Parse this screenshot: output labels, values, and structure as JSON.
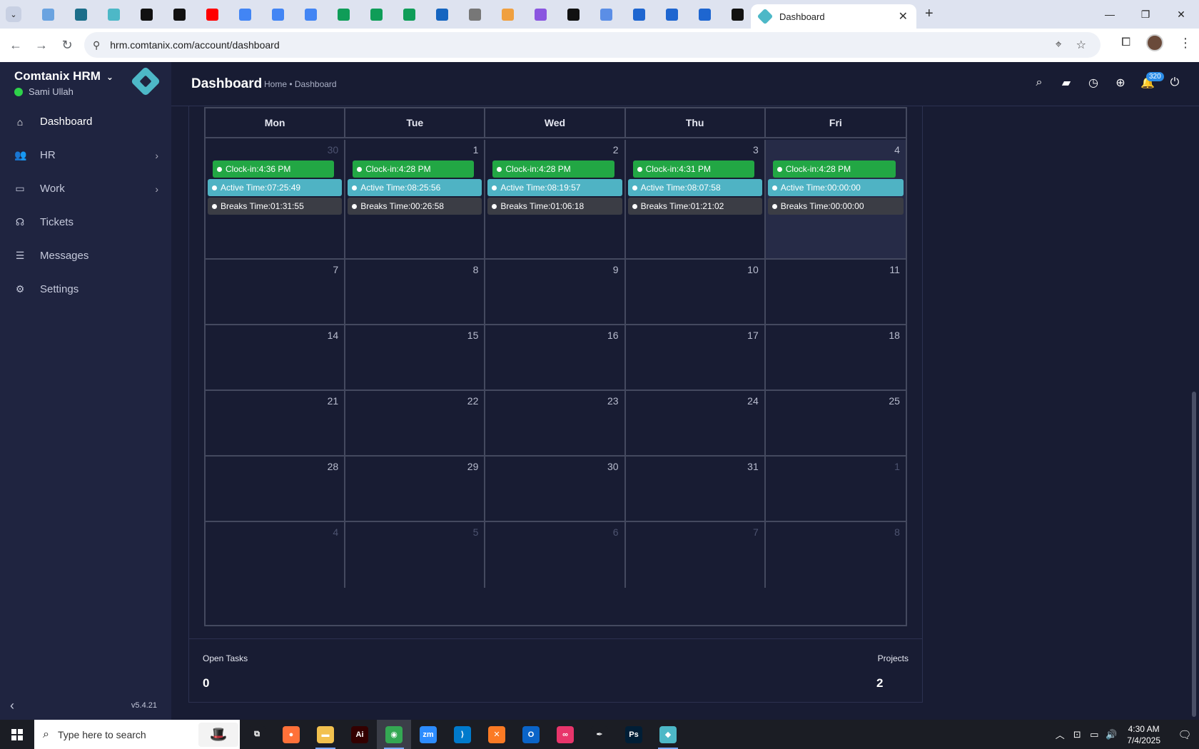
{
  "browser": {
    "active_tab_title": "Dashboard",
    "url": "hrm.comtanix.com/account/dashboard",
    "pinned_tabs": [
      {
        "icon": "globe-icon",
        "color": "#6aa3e0"
      },
      {
        "icon": "vpn-icon",
        "color": "#1c6e8a"
      },
      {
        "icon": "hrm-icon",
        "color": "#4db8c7"
      },
      {
        "icon": "openai-icon",
        "color": "#111111"
      },
      {
        "icon": "bolt-icon",
        "color": "#111111"
      },
      {
        "icon": "youtube-icon",
        "color": "#ff0000"
      },
      {
        "icon": "docs-icon",
        "color": "#4285f4"
      },
      {
        "icon": "docs-icon",
        "color": "#4285f4"
      },
      {
        "icon": "docs-icon",
        "color": "#4285f4"
      },
      {
        "icon": "sheets-icon",
        "color": "#0f9d58"
      },
      {
        "icon": "sheets-icon",
        "color": "#0f9d58"
      },
      {
        "icon": "sheets-icon",
        "color": "#0f9d58"
      },
      {
        "icon": "mj-icon",
        "color": "#1565c0"
      },
      {
        "icon": "globe-icon",
        "color": "#777777"
      },
      {
        "icon": "cat-icon",
        "color": "#f0a040"
      },
      {
        "icon": "braces-icon",
        "color": "#8a55e0"
      },
      {
        "icon": "code-icon",
        "color": "#111111"
      },
      {
        "icon": "grid-icon",
        "color": "#5b8ee6"
      },
      {
        "icon": "forms-icon",
        "color": "#1e66d0"
      },
      {
        "icon": "forms-icon",
        "color": "#1e66d0"
      },
      {
        "icon": "forms-icon",
        "color": "#1e66d0"
      },
      {
        "icon": "m-icon",
        "color": "#111111"
      }
    ]
  },
  "sidebar": {
    "brand": "Comtanix HRM",
    "user": "Sami Ullah",
    "version": "v5.4.21",
    "items": [
      {
        "label": "Dashboard",
        "icon": "home-icon",
        "glyph": "⌂"
      },
      {
        "label": "HR",
        "icon": "users-icon",
        "glyph": "👥"
      },
      {
        "label": "Work",
        "icon": "briefcase-icon",
        "glyph": "▭"
      },
      {
        "label": "Tickets",
        "icon": "headset-icon",
        "glyph": "☊"
      },
      {
        "label": "Messages",
        "icon": "message-icon",
        "glyph": "☰"
      },
      {
        "label": "Settings",
        "icon": "gear-icon",
        "glyph": "⚙"
      }
    ]
  },
  "header": {
    "title": "Dashboard",
    "breadcrumb": "Home • Dashboard",
    "notification_count": "320"
  },
  "calendar": {
    "weekdays": [
      "Mon",
      "Tue",
      "Wed",
      "Thu",
      "Fri"
    ],
    "labels": {
      "clock": "Clock-in: ",
      "active": "Active Time: ",
      "breaks": "Breaks Time: "
    },
    "weeks": [
      [
        {
          "day": "30",
          "dim": true,
          "clock_in": "4:36 PM",
          "active": "07:25:49",
          "breaks": "01:31:55"
        },
        {
          "day": "1",
          "clock_in": "4:28 PM",
          "active": "08:25:56",
          "breaks": "00:26:58"
        },
        {
          "day": "2",
          "clock_in": "4:28 PM",
          "active": "08:19:57",
          "breaks": "01:06:18"
        },
        {
          "day": "3",
          "clock_in": "4:31 PM",
          "active": "08:07:58",
          "breaks": "01:21:02"
        },
        {
          "day": "4",
          "today": true,
          "clock_in": "4:28 PM",
          "active": "00:00:00",
          "breaks": "00:00:00"
        }
      ],
      [
        {
          "day": "7"
        },
        {
          "day": "8"
        },
        {
          "day": "9"
        },
        {
          "day": "10"
        },
        {
          "day": "11"
        }
      ],
      [
        {
          "day": "14"
        },
        {
          "day": "15"
        },
        {
          "day": "16"
        },
        {
          "day": "17"
        },
        {
          "day": "18"
        }
      ],
      [
        {
          "day": "21"
        },
        {
          "day": "22"
        },
        {
          "day": "23"
        },
        {
          "day": "24"
        },
        {
          "day": "25"
        }
      ],
      [
        {
          "day": "28"
        },
        {
          "day": "29"
        },
        {
          "day": "30"
        },
        {
          "day": "31"
        },
        {
          "day": "1",
          "dim": true
        }
      ],
      [
        {
          "day": "4",
          "dim": true
        },
        {
          "day": "5",
          "dim": true
        },
        {
          "day": "6",
          "dim": true
        },
        {
          "day": "7",
          "dim": true
        },
        {
          "day": "8",
          "dim": true
        }
      ]
    ]
  },
  "stats": {
    "open_tasks_label": "Open Tasks",
    "open_tasks_value": "0",
    "projects_label": "Projects",
    "projects_value": "2"
  },
  "taskbar": {
    "search_placeholder": "Type here to search",
    "time": "4:30 AM",
    "date": "7/4/2025",
    "apps": [
      {
        "name": "task-view",
        "label": "",
        "color": "#1b1d24",
        "glyph": "⧉"
      },
      {
        "name": "firefox",
        "label": "",
        "color": "#ff7139",
        "glyph": "●"
      },
      {
        "name": "file-explorer",
        "label": "",
        "color": "#f2c14e",
        "glyph": "▬"
      },
      {
        "name": "illustrator",
        "label": "Ai",
        "color": "#330000",
        "glyph": ""
      },
      {
        "name": "chrome",
        "label": "",
        "color": "#34a853",
        "glyph": "◉"
      },
      {
        "name": "zoom",
        "label": "zm",
        "color": "#2d8cff",
        "glyph": ""
      },
      {
        "name": "vscode",
        "label": "",
        "color": "#007acc",
        "glyph": "⟩"
      },
      {
        "name": "xampp",
        "label": "",
        "color": "#fb7a24",
        "glyph": "✕"
      },
      {
        "name": "outlook",
        "label": "",
        "color": "#0a64c8",
        "glyph": "O"
      },
      {
        "name": "creative-cloud",
        "label": "",
        "color": "#e8356b",
        "glyph": "∞"
      },
      {
        "name": "pen-tool",
        "label": "",
        "color": "#1b1d24",
        "glyph": "✒"
      },
      {
        "name": "photoshop",
        "label": "Ps",
        "color": "#001e36",
        "glyph": ""
      },
      {
        "name": "hrm-app",
        "label": "",
        "color": "#4db8c7",
        "glyph": "◆"
      }
    ]
  }
}
